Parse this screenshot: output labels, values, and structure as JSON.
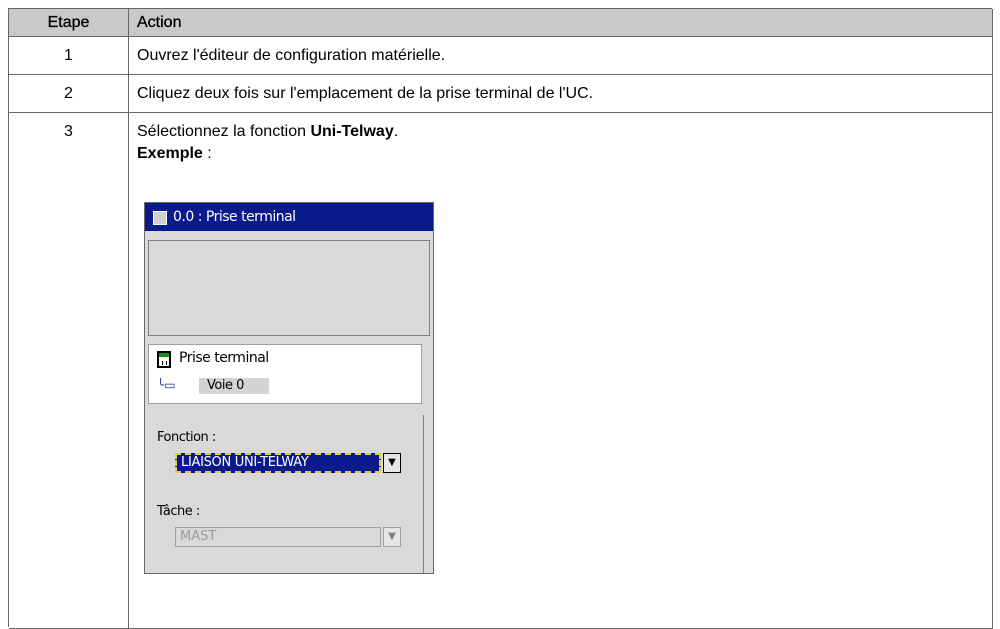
{
  "table": {
    "headers": {
      "step": "Etape",
      "action": "Action"
    },
    "rows": [
      {
        "step": "1",
        "action": "Ouvrez l'éditeur de configuration matérielle."
      },
      {
        "step": "2",
        "action": "Cliquez deux fois sur l'emplacement de la prise terminal de l'UC."
      },
      {
        "step": "3",
        "action_prefix": "Sélectionnez la fonction ",
        "action_bold": "Uni-Telway",
        "action_suffix": ".",
        "example_bold": "Exemple",
        "example_suffix": " :"
      }
    ]
  },
  "dialog": {
    "title": "0.0 : Prise terminal",
    "module_label": "Prise terminal",
    "channel_label": "Voie 0",
    "function_label": "Fonction :",
    "function_value": "LIAISON UNI-TELWAY",
    "task_label": "Tâche :",
    "task_value": "MAST",
    "colors": {
      "title_bar": "#0a1a8c",
      "header": "#c9c9c9"
    },
    "icons": [
      "module-icon",
      "channel-icon",
      "dropdown-arrow-icon"
    ]
  }
}
